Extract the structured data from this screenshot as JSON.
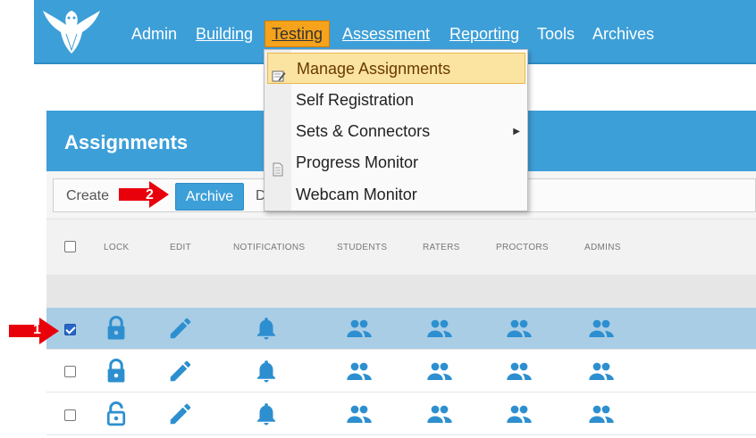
{
  "nav": {
    "items": [
      {
        "label": "Admin"
      },
      {
        "label": "Building"
      },
      {
        "label": "Testing"
      },
      {
        "label": "Assessment"
      },
      {
        "label": "Reporting"
      },
      {
        "label": "Tools"
      },
      {
        "label": "Archives"
      }
    ],
    "active": "Testing",
    "logo_icon": "owl-logo-icon"
  },
  "dropdown": {
    "items": [
      {
        "label": "Manage Assignments",
        "icon": "edit-page-icon",
        "highlighted": true
      },
      {
        "label": "Self Registration"
      },
      {
        "label": "Sets & Connectors",
        "submenu": true
      },
      {
        "label": "Progress Monitor",
        "icon": "document-icon"
      },
      {
        "label": "Webcam Monitor"
      }
    ]
  },
  "panel": {
    "title": "Assignments"
  },
  "toolbar": {
    "create_label": "Create",
    "archive_label": "Archive",
    "partial_label": "D"
  },
  "columns": [
    "LOCK",
    "EDIT",
    "NOTIFICATIONS",
    "STUDENTS",
    "RATERS",
    "PROCTORS",
    "ADMINS"
  ],
  "rows": [
    {
      "checked": true,
      "lock": "locked",
      "selected": true
    },
    {
      "checked": false,
      "lock": "locked",
      "selected": false
    },
    {
      "checked": false,
      "lock": "unlocked",
      "selected": false
    }
  ],
  "annotations": [
    {
      "number": "1"
    },
    {
      "number": "2"
    }
  ],
  "colors": {
    "primary": "#3d9fd8",
    "active_menu": "#f5a31c",
    "selected_row": "#a8cde5",
    "annotation": "#e8000b"
  }
}
